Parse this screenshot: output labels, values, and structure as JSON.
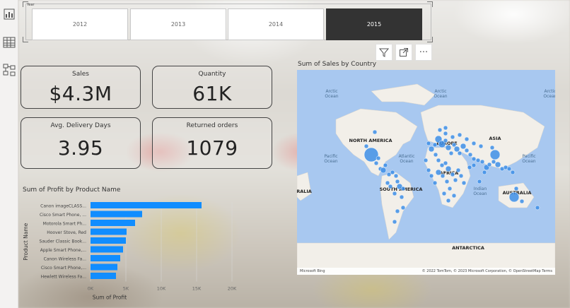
{
  "slicer": {
    "caption": "Year",
    "years": [
      "2012",
      "2013",
      "2014",
      "2015"
    ],
    "selected": "2015"
  },
  "visual_header": {
    "filter_icon": "filter-icon",
    "focus_icon": "focus-mode-icon",
    "more_icon": "more-options-icon",
    "more_label": "···"
  },
  "left_rail": {
    "icons": [
      "report-view-icon",
      "table-view-icon",
      "model-view-icon"
    ]
  },
  "cards": [
    {
      "label": "Sales",
      "value": "$4.3M"
    },
    {
      "label": "Quantity",
      "value": "61K"
    },
    {
      "label": "Avg. Delivery Days",
      "value": "3.95"
    },
    {
      "label": "Returned orders",
      "value": "1079"
    }
  ],
  "colors": {
    "bar": "#118dff",
    "bubble": "#3d8ee6",
    "ocean": "#a8c8f0",
    "land": "#f2efe9",
    "selected_year": "#333333"
  },
  "map": {
    "title": "Sum of Sales by Country",
    "labels": {
      "arctic_left": "Arctic\nOcean",
      "arctic_mid": "Arctic\nOcean",
      "arctic_right": "Arctic\nOcean",
      "north_america": "NORTH AMERICA",
      "europe": "EUROPE",
      "asia": "ASIA",
      "africa": "AFRICA",
      "south_america": "SOUTH AMERICA",
      "australia": "AUSTRALIA",
      "antarctica": "ANTARCTICA",
      "pacific_left": "Pacific\nOcean",
      "pacific_right": "Pacific\nOcean",
      "atlantic": "Atlantic\nOcean",
      "indian": "Indian\nOcean",
      "ralia": "RALIA"
    },
    "attribution_left": "Microsoft Bing",
    "attribution_right": "© 2022 TomTom, © 2023 Microsoft Corporation, © OpenStreetMap  Terms"
  },
  "chart_data": {
    "type": "bar",
    "title": "Sum of Profit by Product Name",
    "xlabel": "Sum of Profit",
    "ylabel": "Product Name",
    "orientation": "horizontal",
    "categories": [
      "Canon imageCLASS...",
      "Cisco Smart Phone, ...",
      "Motorola Smart Ph...",
      "Hoover Stove, Red",
      "Sauder Classic Book...",
      "Apple Smart Phone,...",
      "Canon Wireless Fa...",
      "Cisco Smart Phone,...",
      "Hewlett Wireless Fa..."
    ],
    "values": [
      15700,
      7300,
      6300,
      5100,
      5000,
      4600,
      4200,
      3800,
      3600
    ],
    "xticks": [
      "0K",
      "5K",
      "10K",
      "15K",
      "20K"
    ],
    "xlim": [
      0,
      20000
    ]
  }
}
